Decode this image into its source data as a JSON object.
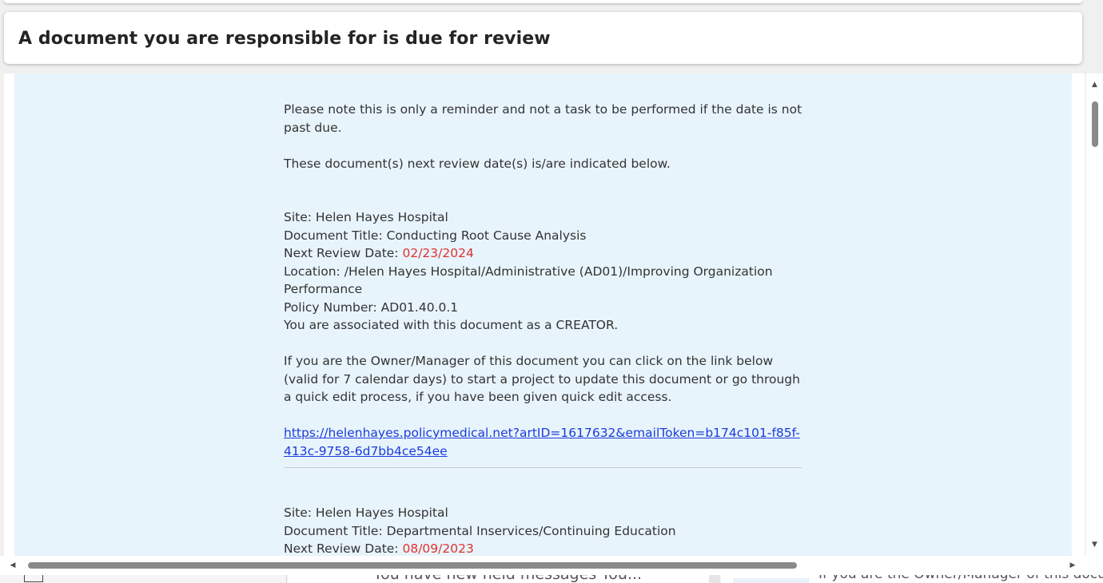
{
  "header": {
    "title": "A document you are responsible for is due for review"
  },
  "email": {
    "intro_line": "Please note this is only a reminder and not a task to be performed if the date is not past due.",
    "dates_line": "These document(s) next review date(s) is/are indicated below.",
    "documents": [
      {
        "site_label": "Site: ",
        "site": "Helen Hayes Hospital",
        "title_label": "Document Title: ",
        "title": "Conducting Root Cause Analysis",
        "next_review_label": "Next Review Date: ",
        "next_review_date": "02/23/2024",
        "location_label": "Location: ",
        "location": "/Helen Hayes Hospital/Administrative (AD01)/Improving Organization Performance",
        "policy_label": "Policy Number: ",
        "policy_number": "AD01.40.0.1",
        "association": "You are associated with this document as a CREATOR.",
        "instructions": "If you are the Owner/Manager of this document you can click on the link below (valid for 7 calendar days) to start a project to update this document or go through a quick edit process, if you have been given quick edit access.",
        "link": "https://helenhayes.policymedical.net?artID=1617632&emailToken=b174c101-f85f-413c-9758-6d7bb4ce54ee"
      },
      {
        "site_label": "Site: ",
        "site": "Helen Hayes Hospital",
        "title_label": "Document Title: ",
        "title": "Departmental Inservices/Continuing Education",
        "next_review_label": "Next Review Date: ",
        "next_review_date": "08/09/2023"
      }
    ],
    "date_color": "#e0312f",
    "link_color": "#1a3cdc"
  },
  "background": {
    "middle_preview": "You have new held messages You...",
    "right_preview": "If you are the Owner/Manager of this document"
  },
  "icons": {
    "scroll_up": "▲",
    "scroll_down": "▼",
    "scroll_left": "◀",
    "scroll_right": "▶"
  }
}
